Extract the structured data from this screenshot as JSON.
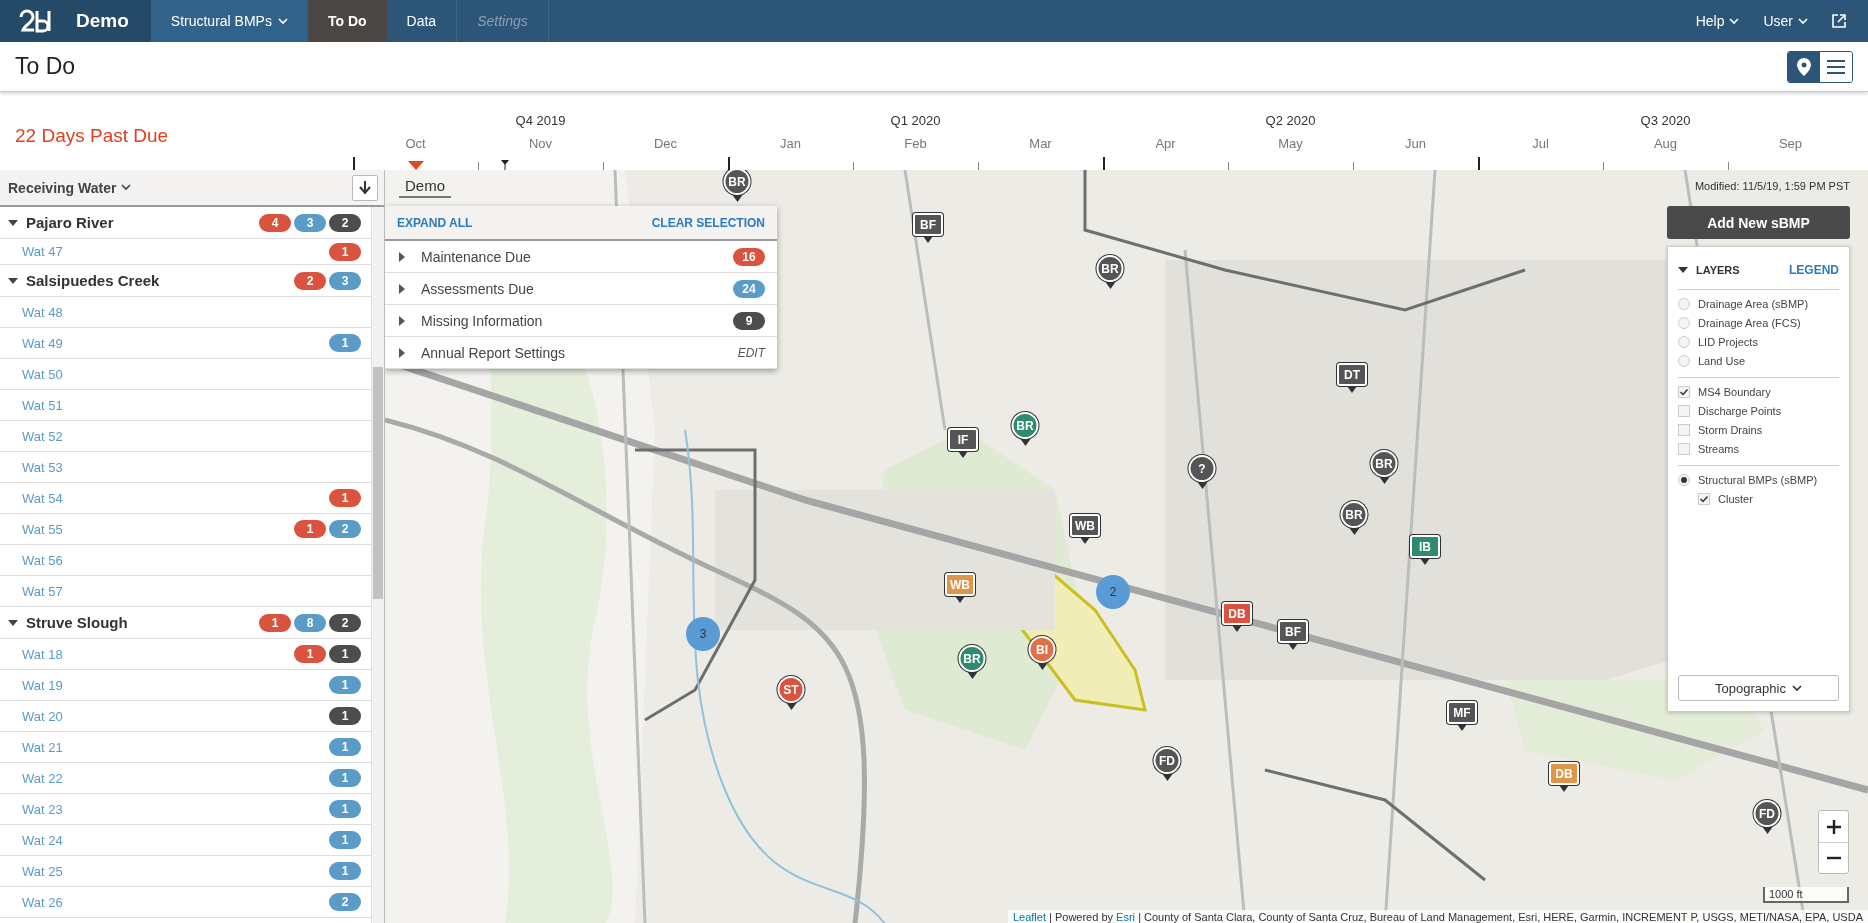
{
  "nav": {
    "brand": "Demo",
    "items": [
      {
        "label": "Structural BMPs",
        "dropdown": true,
        "selected": false,
        "disabled": false
      },
      {
        "label": "To Do",
        "dropdown": false,
        "selected": true,
        "disabled": false
      },
      {
        "label": "Data",
        "dropdown": false,
        "selected": false,
        "disabled": false
      },
      {
        "label": "Settings",
        "dropdown": false,
        "selected": false,
        "disabled": true
      }
    ],
    "right": [
      {
        "label": "Help"
      },
      {
        "label": "User"
      }
    ]
  },
  "page_title": "To Do",
  "view_toggle": [
    {
      "kind": "map",
      "selected": true
    },
    {
      "kind": "list",
      "selected": false
    }
  ],
  "past_due": "22 Days Past Due",
  "timeline": {
    "quarters": [
      "Q4 2019",
      "Q1 2020",
      "Q2 2020",
      "Q3 2020"
    ],
    "months": [
      "Oct",
      "Nov",
      "Dec",
      "Jan",
      "Feb",
      "Mar",
      "Apr",
      "May",
      "Jun",
      "Jul",
      "Aug",
      "Sep"
    ]
  },
  "sidebar": {
    "group_by": "Receiving Water",
    "groups": [
      {
        "name": "Pajaro River",
        "expanded": true,
        "badges": [
          {
            "count": "4",
            "color": "#d9533f"
          },
          {
            "count": "3",
            "color": "#5b9bc8"
          },
          {
            "count": "2",
            "color": "#4d4d4d"
          }
        ],
        "children": [
          {
            "name": "Wat 47",
            "badges": [
              {
                "count": "1",
                "color": "#d9533f"
              }
            ]
          }
        ]
      },
      {
        "name": "Salsipuedes Creek",
        "expanded": true,
        "badges": [
          {
            "count": "2",
            "color": "#d9533f"
          },
          {
            "count": "3",
            "color": "#5b9bc8"
          }
        ],
        "children": [
          {
            "name": "Wat 48"
          },
          {
            "name": "Wat 49",
            "badges": [
              {
                "count": "1",
                "color": "#5b9bc8"
              }
            ]
          },
          {
            "name": "Wat 50"
          },
          {
            "name": "Wat 51"
          },
          {
            "name": "Wat 52"
          },
          {
            "name": "Wat 53"
          },
          {
            "name": "Wat 54",
            "badges": [
              {
                "count": "1",
                "color": "#d9533f"
              }
            ]
          },
          {
            "name": "Wat 55",
            "badges": [
              {
                "count": "1",
                "color": "#d9533f"
              },
              {
                "count": "2",
                "color": "#5b9bc8"
              }
            ]
          },
          {
            "name": "Wat 56"
          },
          {
            "name": "Wat 57"
          }
        ]
      },
      {
        "name": "Struve Slough",
        "expanded": true,
        "badges": [
          {
            "count": "1",
            "color": "#d9533f"
          },
          {
            "count": "8",
            "color": "#5b9bc8"
          },
          {
            "count": "2",
            "color": "#4d4d4d"
          }
        ],
        "children": [
          {
            "name": "Wat 18",
            "badges": [
              {
                "count": "1",
                "color": "#d9533f"
              },
              {
                "count": "1",
                "color": "#4d4d4d"
              }
            ]
          },
          {
            "name": "Wat 19",
            "badges": [
              {
                "count": "1",
                "color": "#5b9bc8"
              }
            ]
          },
          {
            "name": "Wat 20",
            "badges": [
              {
                "count": "1",
                "color": "#4d4d4d"
              }
            ]
          },
          {
            "name": "Wat 21",
            "badges": [
              {
                "count": "1",
                "color": "#5b9bc8"
              }
            ]
          },
          {
            "name": "Wat 22",
            "badges": [
              {
                "count": "1",
                "color": "#5b9bc8"
              }
            ]
          },
          {
            "name": "Wat 23",
            "badges": [
              {
                "count": "1",
                "color": "#5b9bc8"
              }
            ]
          },
          {
            "name": "Wat 24",
            "badges": [
              {
                "count": "1",
                "color": "#5b9bc8"
              }
            ]
          },
          {
            "name": "Wat 25",
            "badges": [
              {
                "count": "1",
                "color": "#5b9bc8"
              }
            ]
          },
          {
            "name": "Wat 26",
            "badges": [
              {
                "count": "2",
                "color": "#5b9bc8"
              }
            ]
          }
        ]
      }
    ]
  },
  "todo_panel": {
    "expand_all": "EXPAND ALL",
    "clear_selection": "CLEAR SELECTION",
    "rows": [
      {
        "label": "Maintenance Due",
        "expanded": false,
        "badge": {
          "count": "16",
          "color": "#d9533f"
        }
      },
      {
        "label": "Assessments Due",
        "expanded": false,
        "badge": {
          "count": "24",
          "color": "#5b9bc8"
        }
      },
      {
        "label": "Missing Information",
        "expanded": false,
        "badge": {
          "count": "9",
          "color": "#4d4d4d"
        }
      },
      {
        "label": "Annual Report Settings",
        "expanded": false,
        "action": "EDIT"
      }
    ]
  },
  "map": {
    "layer_label": "Demo",
    "modified": "Modified: 11/5/19, 1:59 PM PST",
    "add_button": "Add New sBMP",
    "markers": [
      {
        "label": "BR",
        "kind": "circle",
        "color": "#555555"
      },
      {
        "label": "BF",
        "kind": "square",
        "color": "#555555"
      },
      {
        "label": "BR",
        "kind": "circle",
        "color": "#555555"
      },
      {
        "label": "BR",
        "kind": "circle",
        "color": "#2e8b6e"
      },
      {
        "label": "IF",
        "kind": "square",
        "color": "#555555"
      },
      {
        "label": "?",
        "kind": "circle",
        "color": "#555555"
      },
      {
        "label": "DT",
        "kind": "square",
        "color": "#555555"
      },
      {
        "label": "BR",
        "kind": "circle",
        "color": "#555555"
      },
      {
        "label": "BR",
        "kind": "circle",
        "color": "#555555"
      },
      {
        "label": "WB",
        "kind": "square",
        "color": "#555555"
      },
      {
        "label": "IB",
        "kind": "square",
        "color": "#2e8b6e"
      },
      {
        "label": "WB",
        "kind": "square",
        "color": "#e0954a"
      },
      {
        "label": "2",
        "kind": "cluster",
        "color": "#5b9bd5"
      },
      {
        "label": "3",
        "kind": "cluster",
        "color": "#5b9bd5"
      },
      {
        "label": "DB",
        "kind": "square",
        "color": "#d9533f"
      },
      {
        "label": "BF",
        "kind": "square",
        "color": "#555555"
      },
      {
        "label": "BR",
        "kind": "circle",
        "color": "#2e8b6e"
      },
      {
        "label": "BI",
        "kind": "circle",
        "color": "#e0704a"
      },
      {
        "label": "ST",
        "kind": "circle",
        "color": "#d9533f"
      },
      {
        "label": "MF",
        "kind": "square",
        "color": "#555555"
      },
      {
        "label": "FD",
        "kind": "circle",
        "color": "#555555"
      },
      {
        "label": "DB",
        "kind": "square",
        "color": "#e0954a"
      },
      {
        "label": "FD",
        "kind": "circle",
        "color": "#555555"
      }
    ],
    "scale": "1000 ft",
    "attribution": [
      {
        "text": "Leaflet",
        "link": true
      },
      {
        "text": "| Powered by",
        "link": false
      },
      {
        "text": "Esri",
        "link": true
      },
      {
        "text": "| County of Santa Clara, County of Santa Cruz, Bureau of Land Management, Esri, HERE, Garmin, INCREMENT P, USGS, METI/NASA, EPA, USDA",
        "link": false
      }
    ]
  },
  "layers": {
    "title": "LAYERS",
    "expanded": true,
    "legend": "LEGEND",
    "groups": [
      {
        "items": [
          {
            "label": "Drainage Area (sBMP)",
            "kind": "radio",
            "checked": false
          },
          {
            "label": "Drainage Area (FCS)",
            "kind": "radio",
            "checked": false
          },
          {
            "label": "LID Projects",
            "kind": "radio",
            "checked": false
          },
          {
            "label": "Land Use",
            "kind": "radio",
            "checked": false
          }
        ]
      },
      {
        "items": [
          {
            "label": "MS4 Boundary",
            "kind": "checkbox",
            "checked": true
          },
          {
            "label": "Discharge Points",
            "kind": "checkbox",
            "checked": false
          },
          {
            "label": "Storm Drains",
            "kind": "checkbox",
            "checked": false
          },
          {
            "label": "Streams",
            "kind": "checkbox",
            "checked": false
          }
        ]
      },
      {
        "items": [
          {
            "label": "Structural BMPs (sBMP)",
            "kind": "radio",
            "checked": true,
            "children": [
              {
                "label": "Cluster",
                "kind": "checkbox",
                "checked": true
              }
            ]
          }
        ]
      }
    ],
    "basemap": "Topographic"
  }
}
